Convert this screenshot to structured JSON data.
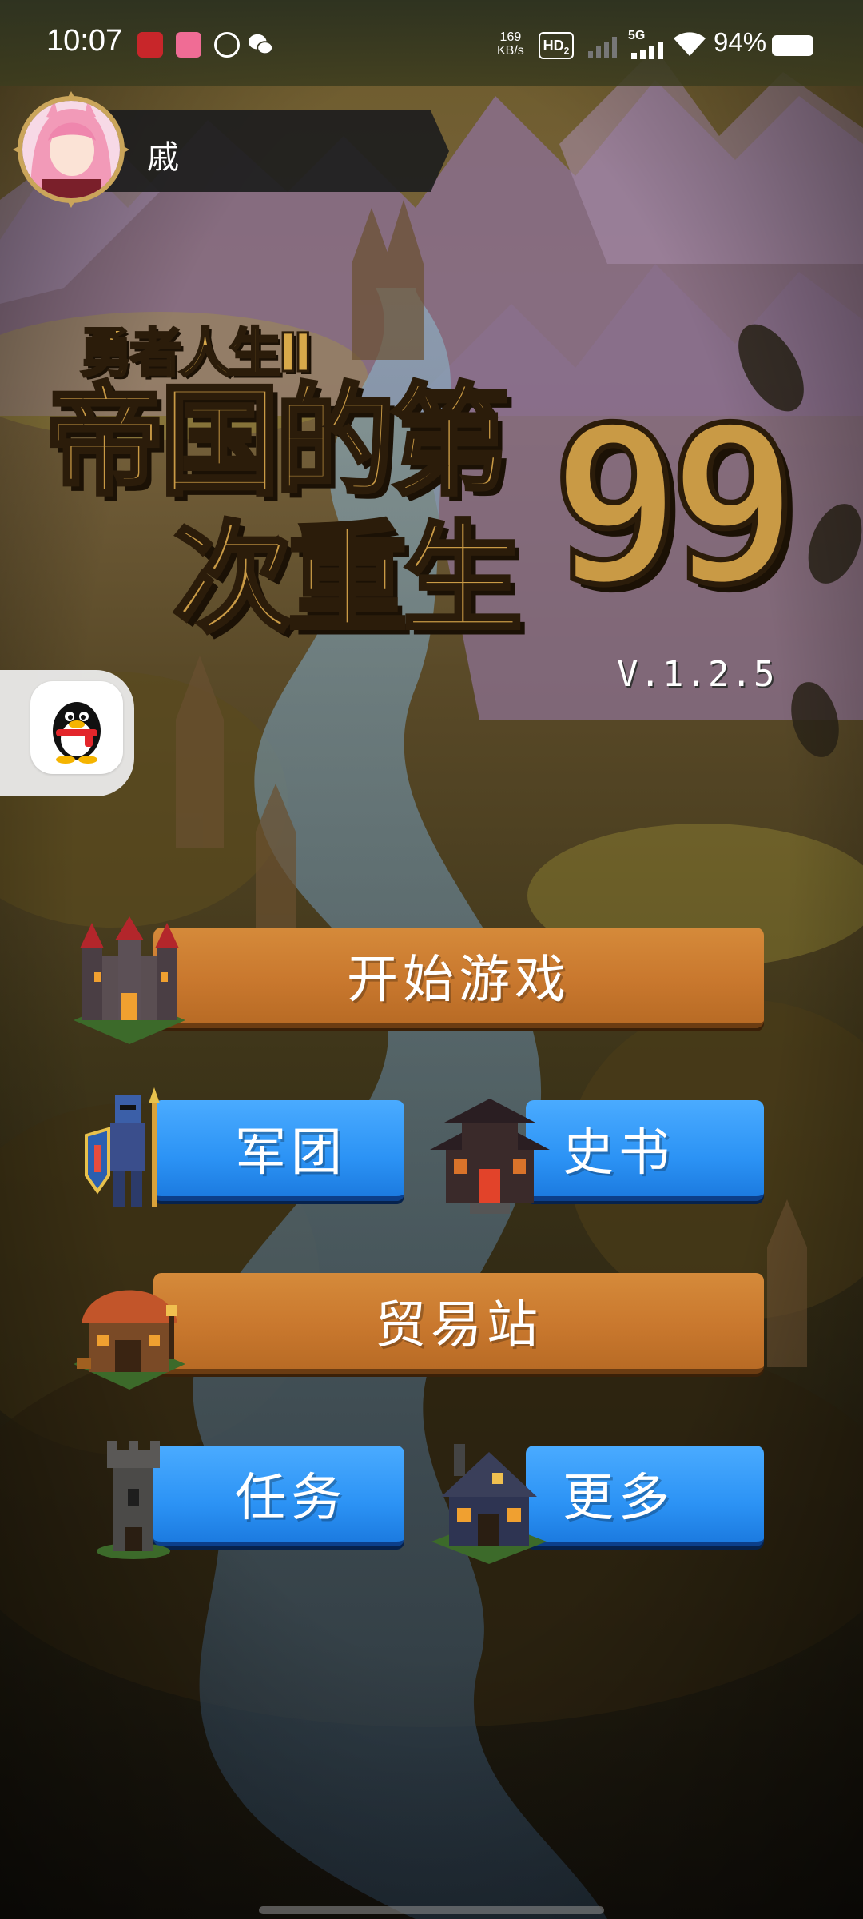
{
  "status_bar": {
    "time": "10:07",
    "net_speed_value": "169",
    "net_speed_unit": "KB/s",
    "hd_label": "HD",
    "hd_sub": "2",
    "network_type": "5G",
    "battery_percent": "94%",
    "app_icons": [
      "app-red-icon",
      "bilibili-icon",
      "browser-icon",
      "wechat-icon"
    ]
  },
  "profile": {
    "name": "戚"
  },
  "title": {
    "subtitle": "勇者人生Ⅱ",
    "line1": "帝国的第",
    "line2": "次重生",
    "number": "99",
    "version": "V.1.2.5"
  },
  "floating": {
    "qq_icon": "qq-penguin-icon"
  },
  "menu": {
    "start": "开始游戏",
    "legion": "军团",
    "history": "史书",
    "trading": "贸易站",
    "tasks": "任务",
    "more": "更多"
  },
  "colors": {
    "orange_button": "#c9782e",
    "blue_button": "#2c93f5",
    "title_gold": "#c99a45"
  }
}
